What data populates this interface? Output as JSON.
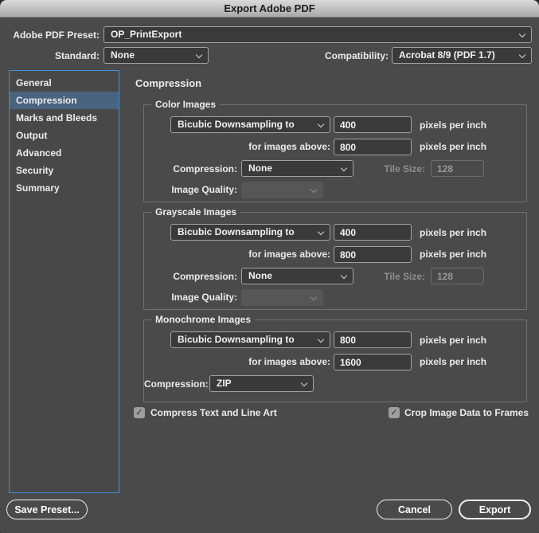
{
  "window": {
    "title": "Export Adobe PDF"
  },
  "header": {
    "preset": {
      "label": "Adobe PDF Preset:",
      "value": "OP_PrintExport"
    },
    "standard": {
      "label": "Standard:",
      "value": "None"
    },
    "compatibility": {
      "label": "Compatibility:",
      "value": "Acrobat 8/9 (PDF 1.7)"
    }
  },
  "sidebar": {
    "items": [
      {
        "label": "General",
        "selected": false
      },
      {
        "label": "Compression",
        "selected": true
      },
      {
        "label": "Marks and Bleeds",
        "selected": false
      },
      {
        "label": "Output",
        "selected": false
      },
      {
        "label": "Advanced",
        "selected": false
      },
      {
        "label": "Security",
        "selected": false
      },
      {
        "label": "Summary",
        "selected": false
      }
    ]
  },
  "main": {
    "heading": "Compression",
    "sections": [
      {
        "title": "Color Images",
        "downsample": "Bicubic Downsampling to",
        "ppi": "400",
        "ppi_unit": "pixels per inch",
        "above_label": "for images above:",
        "above_ppi": "800",
        "above_unit": "pixels per inch",
        "compression_label": "Compression:",
        "compression": "None",
        "tile_size_label": "Tile Size:",
        "tile_size": "128",
        "image_quality_label": "Image Quality:",
        "image_quality": ""
      },
      {
        "title": "Grayscale Images",
        "downsample": "Bicubic Downsampling to",
        "ppi": "400",
        "ppi_unit": "pixels per inch",
        "above_label": "for images above:",
        "above_ppi": "800",
        "above_unit": "pixels per inch",
        "compression_label": "Compression:",
        "compression": "None",
        "tile_size_label": "Tile Size:",
        "tile_size": "128",
        "image_quality_label": "Image Quality:",
        "image_quality": ""
      },
      {
        "title": "Monochrome Images",
        "downsample": "Bicubic Downsampling to",
        "ppi": "800",
        "ppi_unit": "pixels per inch",
        "above_label": "for images above:",
        "above_ppi": "1600",
        "above_unit": "pixels per inch",
        "compression_label": "Compression:",
        "compression": "ZIP"
      }
    ],
    "options": [
      {
        "label": "Compress Text and Line Art",
        "checked": true
      },
      {
        "label": "Crop Image Data to Frames",
        "checked": true
      }
    ]
  },
  "footer": {
    "save_preset": "Save Preset...",
    "cancel": "Cancel",
    "export": "Export"
  },
  "colors": {
    "dialog_bg": "#4a4a4a",
    "selection_blue": "#4a637e",
    "focus_border_blue": "#3e8ee2",
    "field_bg": "#3a3a3a"
  }
}
